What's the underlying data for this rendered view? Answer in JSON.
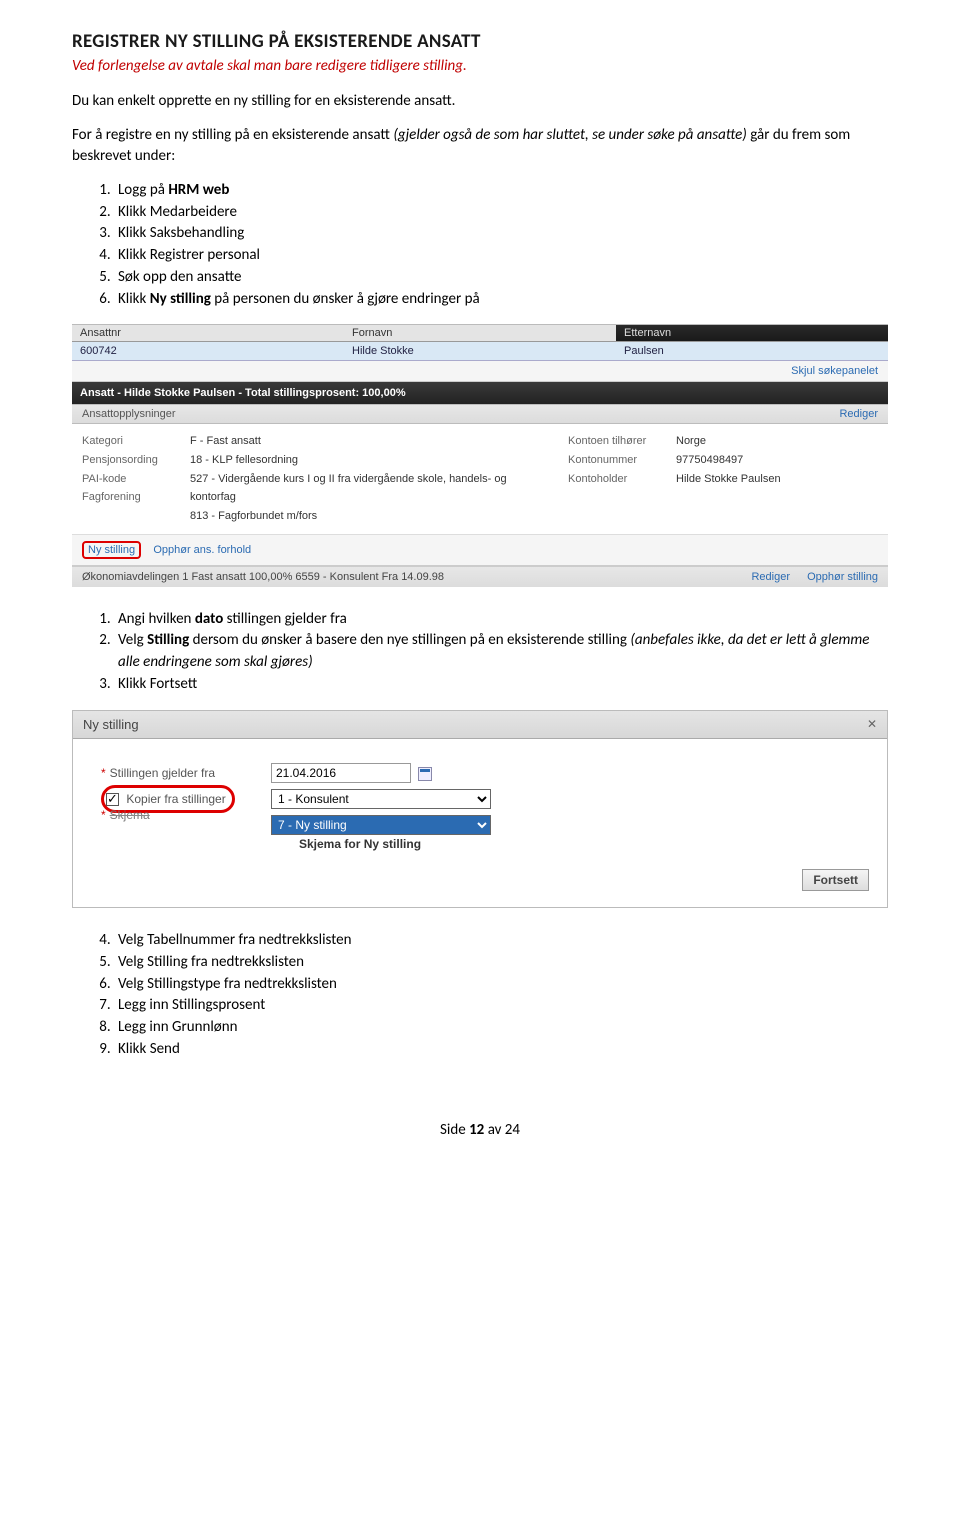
{
  "title": "REGISTRER NY STILLING PÅ EKSISTERENDE ANSATT",
  "subtitle": "Ved forlengelse av avtale skal man bare redigere tidligere stilling.",
  "para1": "Du kan enkelt opprette en ny stilling for en eksisterende ansatt.",
  "para2_a": "For å registre en ny stilling på en eksisterende ansatt ",
  "para2_b": "(gjelder også de som har sluttet, se under søke på ansatte)",
  "para2_c": " går du frem som beskrevet under:",
  "steps_a": [
    {
      "pre": "Logg på ",
      "bold": "HRM web",
      "post": ""
    },
    {
      "pre": "Klikk Medarbeidere",
      "bold": "",
      "post": ""
    },
    {
      "pre": "Klikk Saksbehandling",
      "bold": "",
      "post": ""
    },
    {
      "pre": "Klikk Registrer personal",
      "bold": "",
      "post": ""
    },
    {
      "pre": "Søk opp den ansatte",
      "bold": "",
      "post": ""
    },
    {
      "pre": "Klikk ",
      "bold": "Ny stilling",
      "post": " på personen du ønsker å gjøre endringer på"
    }
  ],
  "shot1": {
    "hdr": {
      "c1": "Ansattnr",
      "c2": "Fornavn",
      "c3": "Etternavn"
    },
    "row": {
      "c1": "600742",
      "c2": "Hilde Stokke",
      "c3": "Paulsen"
    },
    "skjul": "Skjul søkepanelet",
    "darkbar": "Ansatt - Hilde Stokke Paulsen - Total stillingsprosent: 100,00%",
    "panel_label": "Ansattopplysninger",
    "rediger": "Rediger",
    "left_labels": [
      "Kategori",
      "Pensjonsording",
      "PAI-kode",
      "Fagforening"
    ],
    "left_vals": [
      "F - Fast ansatt",
      "18 - KLP fellesordning",
      "527 - Vidergående kurs I og II fra vidergående skole, handels- og kontorfag",
      "813 - Fagforbundet m/fors"
    ],
    "right_labels": [
      "Kontoen tilhører",
      "Kontonummer",
      "Kontoholder"
    ],
    "right_vals": [
      "Norge",
      "97750498497",
      "Hilde Stokke Paulsen"
    ],
    "ny_stilling": "Ny stilling",
    "opphor": "Opphør ans. forhold",
    "bottom_left": "Økonomiavdelingen   1   Fast ansatt   100,00%   6559 - Konsulent   Fra  14.09.98",
    "bottom_r1": "Rediger",
    "bottom_r2": "Opphør stilling"
  },
  "steps_b": [
    {
      "pre": "Angi hvilken ",
      "bold": "dato",
      "post": " stillingen gjelder fra"
    },
    {
      "pre": "Velg ",
      "bold": "Stilling",
      "post": " dersom du ønsker å basere den nye stillingen på en eksisterende stilling ",
      "italic": "(anbefales ikke, da det er lett å glemme alle endringene som skal gjøres)"
    },
    {
      "pre": "Klikk Fortsett",
      "bold": "",
      "post": ""
    }
  ],
  "shot2": {
    "title": "Ny stilling",
    "row1_label": "Stillingen gjelder fra",
    "row1_val": "21.04.2016",
    "row2_label": "Kopier fra stillinger",
    "row2_val": "1 - Konsulent",
    "row3_label": "Skjema",
    "row3_val": "7 - Ny stilling",
    "desc": "Skjema for Ny stilling",
    "fortsett": "Fortsett"
  },
  "steps_c": [
    "Velg Tabellnummer fra nedtrekkslisten",
    "Velg Stilling fra nedtrekkslisten",
    "Velg Stillingstype fra nedtrekkslisten",
    "Legg inn Stillingsprosent",
    "Legg inn Grunnlønn",
    "Klikk Send"
  ],
  "footer_a": "Side ",
  "footer_b": "12",
  "footer_c": " av 24"
}
